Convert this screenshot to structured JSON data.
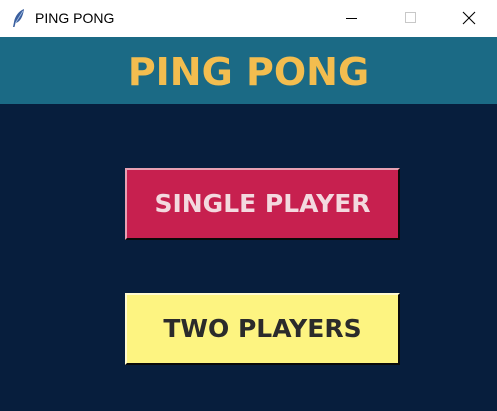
{
  "window": {
    "title": "PING PONG",
    "icon": "feather-icon",
    "controls": {
      "minimize": "minimize-icon",
      "maximize": "maximize-icon",
      "close": "close-icon"
    }
  },
  "header": {
    "title": "PING PONG"
  },
  "menu": {
    "single_player_label": "SINGLE PLAYER",
    "two_players_label": "TWO PLAYERS"
  },
  "colors": {
    "header_bg": "#1b6a85",
    "header_text": "#f3bd4f",
    "body_bg": "#071e3d",
    "single_player_bg": "#c7204f",
    "two_players_bg": "#fdf481"
  }
}
